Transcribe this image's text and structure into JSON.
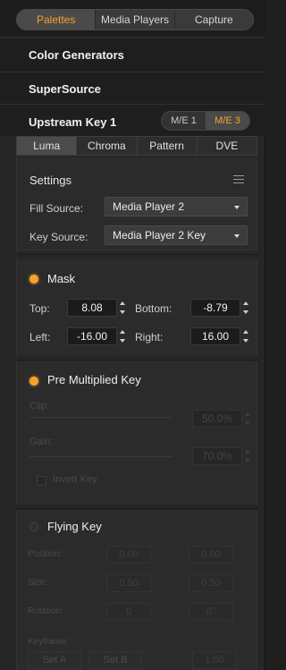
{
  "tabs": [
    "Palettes",
    "Media Players",
    "Capture"
  ],
  "sections": {
    "color_generators": "Color Generators",
    "supersource": "SuperSource"
  },
  "usk": {
    "title": "Upstream Key 1",
    "me_buttons": [
      "M/E 1",
      "M/E 3"
    ],
    "subtabs": [
      "Luma",
      "Chroma",
      "Pattern",
      "DVE"
    ]
  },
  "settings": {
    "title": "Settings",
    "fill_label": "Fill Source:",
    "fill_value": "Media Player 2",
    "key_label": "Key Source:",
    "key_value": "Media Player 2 Key"
  },
  "mask": {
    "label": "Mask",
    "top_label": "Top:",
    "top_value": "8.08",
    "bottom_label": "Bottom:",
    "bottom_value": "-8.79",
    "left_label": "Left:",
    "left_value": "-16.00",
    "right_label": "Right:",
    "right_value": "16.00"
  },
  "premult": {
    "label": "Pre Multiplied Key",
    "clip_label": "Clip:",
    "clip_value": "50.0%",
    "gain_label": "Gain:",
    "gain_value": "70.0%",
    "invert_label": "Invert Key"
  },
  "flying": {
    "label": "Flying Key",
    "position_label": "Position:",
    "x_value": "0.00",
    "y_value": "0.00",
    "size_label": "Size:",
    "size_x": "0.50",
    "size_y": "0.50",
    "rotation_label": "Rotation:",
    "rotation_value": "0",
    "rotation_deg": "0°",
    "keyframe_label": "Keyframe:",
    "set_a": "Set A",
    "set_b": "Set B",
    "rate_value": "1:00"
  },
  "colors": {
    "accent": "#f5a22d"
  }
}
